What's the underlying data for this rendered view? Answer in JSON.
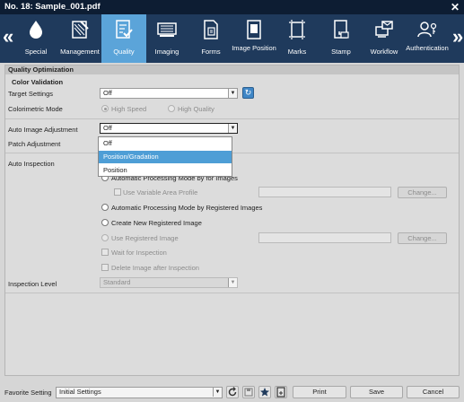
{
  "window": {
    "title": "No. 18: Sample_001.pdf",
    "close": "✕"
  },
  "toolbar": {
    "nav_prev": "«",
    "nav_next": "»",
    "tabs": [
      {
        "label": "Special",
        "icon": "drop-icon"
      },
      {
        "label": "Management",
        "icon": "management-icon"
      },
      {
        "label": "Quality",
        "icon": "quality-checklist-icon",
        "active": true
      },
      {
        "label": "Imaging",
        "icon": "imaging-icon"
      },
      {
        "label": "Forms",
        "icon": "forms-icon"
      },
      {
        "label": "Image Position",
        "icon": "image-position-icon"
      },
      {
        "label": "Marks",
        "icon": "marks-icon"
      },
      {
        "label": "Stamp",
        "icon": "stamp-icon"
      },
      {
        "label": "Workflow",
        "icon": "workflow-icon"
      },
      {
        "label": "Authentication",
        "icon": "authentication-icon"
      }
    ]
  },
  "section": {
    "title": "Quality Optimization",
    "color_validation": {
      "title": "Color Validation",
      "target_settings_label": "Target Settings",
      "target_settings_value": "Off",
      "colorimetric_mode_label": "Colorimetric Mode",
      "high_speed": "High Speed",
      "high_quality": "High Quality"
    },
    "auto_image_adjustment_label": "Auto Image Adjustment",
    "auto_image_adjustment_value": "Off",
    "dropdown_options": [
      "Off",
      "Position/Gradation",
      "Position"
    ],
    "patch_adjustment_label": "Patch Adjustment",
    "auto_inspection": {
      "label": "Auto Inspection",
      "auto_processing_for_images": "Automatic Processing Mode by for Images",
      "use_variable_area_profile": "Use Variable Area Profile",
      "change_1": "Change...",
      "auto_processing_registered": "Automatic Processing Mode by Registered Images",
      "create_new_registered": "Create New Registered Image",
      "use_registered": "Use Registered Image",
      "change_2": "Change...",
      "wait_for_inspection": "Wait for Inspection",
      "delete_image_after": "Delete Image after Inspection"
    },
    "inspection_level_label": "Inspection Level",
    "inspection_level_value": "Standard"
  },
  "footer": {
    "favorite_label": "Favorite Setting",
    "favorite_value": "Initial Settings",
    "print": "Print",
    "save": "Save",
    "cancel": "Cancel"
  }
}
